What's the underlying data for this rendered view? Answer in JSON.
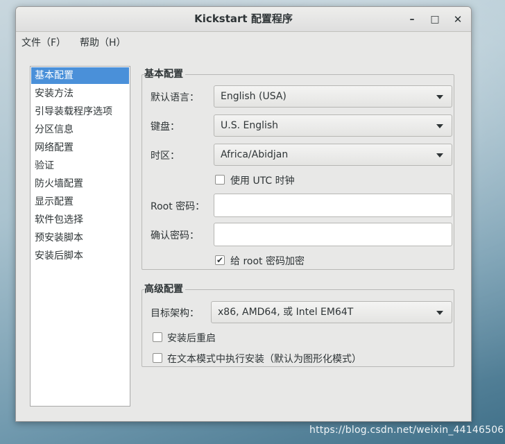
{
  "window": {
    "title": "Kickstart 配置程序",
    "controls": {
      "minimize": "–",
      "maximize": "□",
      "close": "✕"
    }
  },
  "menubar": {
    "items": [
      {
        "label": "文件（F）"
      },
      {
        "label": "帮助（H）"
      }
    ]
  },
  "sidebar": {
    "items": [
      {
        "label": "基本配置",
        "selected": true
      },
      {
        "label": "安装方法"
      },
      {
        "label": "引导装载程序选项"
      },
      {
        "label": "分区信息"
      },
      {
        "label": "网络配置"
      },
      {
        "label": "验证"
      },
      {
        "label": "防火墙配置"
      },
      {
        "label": "显示配置"
      },
      {
        "label": "软件包选择"
      },
      {
        "label": "预安装脚本"
      },
      {
        "label": "安装后脚本"
      }
    ]
  },
  "basic": {
    "title": "基本配置",
    "language_label": "默认语言：",
    "language_value": "English (USA)",
    "keyboard_label": "键盘：",
    "keyboard_value": "U.S. English",
    "timezone_label": "时区：",
    "timezone_value": "Africa/Abidjan",
    "utc_label": "使用  UTC 时钟",
    "utc_checked": false,
    "root_pw_label": "Root 密码：",
    "root_pw_value": "",
    "confirm_pw_label": "确认密码：",
    "confirm_pw_value": "",
    "encrypt_label": "给  root 密码加密",
    "encrypt_checked": true
  },
  "advanced": {
    "title": "高级配置",
    "arch_label": "目标架构：",
    "arch_value": "x86, AMD64, 或  Intel EM64T",
    "reboot_label": "安装后重启",
    "reboot_checked": false,
    "textmode_label": "在文本模式中执行安装（默认为图形化模式）",
    "textmode_checked": false
  },
  "icons": {
    "checkmark": "✔",
    "dropdown": "chevron-down-icon"
  },
  "watermark": "https://blog.csdn.net/weixin_44146506"
}
